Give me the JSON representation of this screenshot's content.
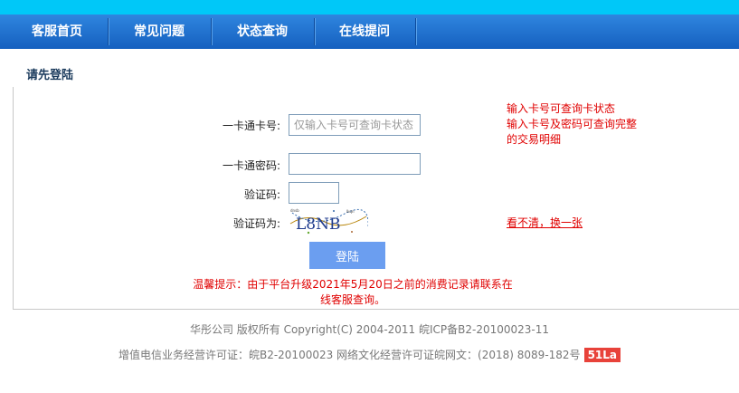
{
  "nav": {
    "items": [
      {
        "label": "客服首页"
      },
      {
        "label": "常见问题"
      },
      {
        "label": "状态查询"
      },
      {
        "label": "在线提问"
      }
    ]
  },
  "page_title": "请先登陆",
  "form": {
    "card_label": "一卡通卡号:",
    "card_placeholder": "仅输入卡号可查询卡状态",
    "card_value": "",
    "password_label": "一卡通密码:",
    "password_value": "",
    "code_label": "验证码:",
    "code_value": "",
    "captcha_label": "验证码为:",
    "captcha_text": "L8NB",
    "refresh_link": "看不清，换一张",
    "login_button": "登陆"
  },
  "hint": {
    "line1": "输入卡号可查询卡状态",
    "line2": "输入卡号及密码可查询完整",
    "line3": "的交易明细"
  },
  "notice": "温馨提示：由于平台升级2021年5月20日之前的消费记录请联系在线客服查询。",
  "footer": {
    "line1": "华彤公司 版权所有 Copyright(C) 2004-2011 皖ICP备B2-20100023-11",
    "line2": "增值电信业务经营许可证：皖B2-20100023 网络文化经营许可证皖网文：(2018) 8089-182号",
    "badge": "51La"
  },
  "colors": {
    "topbar": "#00c8f8",
    "nav": "#1f72d0",
    "alert_red": "#e00000",
    "button": "#6b9ef0"
  }
}
